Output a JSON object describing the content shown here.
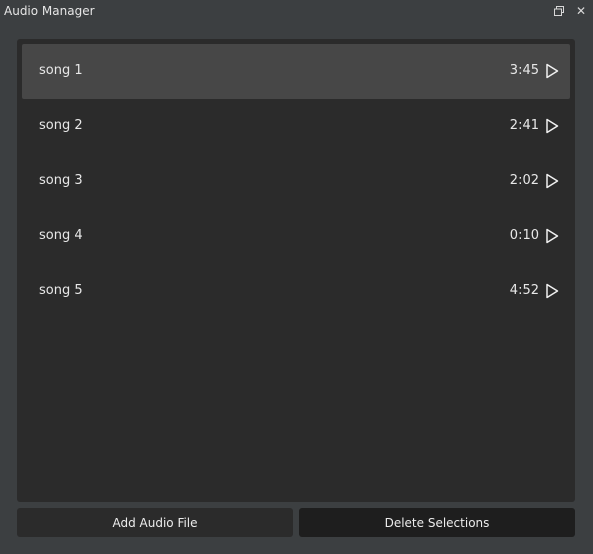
{
  "window": {
    "title": "Audio Manager",
    "restore_icon": "restore-window-icon",
    "close_icon": "close-icon",
    "close_glyph": "✕"
  },
  "songs": [
    {
      "name": "song 1",
      "duration": "3:45",
      "selected": true
    },
    {
      "name": "song 2",
      "duration": "2:41",
      "selected": false
    },
    {
      "name": "song 3",
      "duration": "2:02",
      "selected": false
    },
    {
      "name": "song 4",
      "duration": "0:10",
      "selected": false
    },
    {
      "name": "song 5",
      "duration": "4:52",
      "selected": false
    }
  ],
  "play_icon": "play-icon",
  "buttons": {
    "add_label": "Add Audio File",
    "delete_label": "Delete Selections"
  },
  "colors": {
    "background": "#3c3f41",
    "panel": "#2b2b2b",
    "selected_row": "#474747",
    "delete_button": "#1e1e1e",
    "text": "#e8e8e8"
  }
}
